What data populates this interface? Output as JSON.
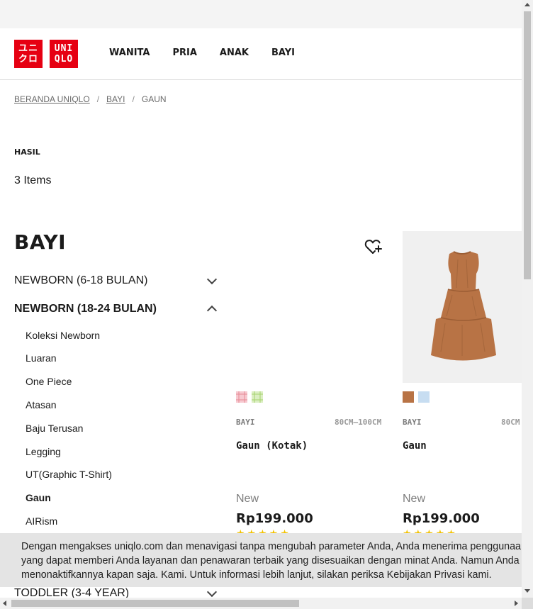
{
  "brand": {
    "logo_top": "ユニ",
    "logo_bottom": "クロ",
    "logo2_top": "UNI",
    "logo2_bottom": "QLO",
    "color": "#e60012"
  },
  "nav": [
    "WANITA",
    "PRIA",
    "ANAK",
    "BAYI"
  ],
  "breadcrumb": {
    "home": "BERANDA UNIQLO",
    "category": "BAYI",
    "current": "GAUN",
    "separator": "/"
  },
  "results": {
    "heading": "HASIL",
    "count": "3 Items"
  },
  "sidebar": {
    "title": "BAYI",
    "sections": [
      {
        "label": "NEWBORN (6-18 BULAN)",
        "expanded": false
      },
      {
        "label": "NEWBORN (18-24 BULAN)",
        "expanded": true
      }
    ],
    "subitems": [
      "Koleksi Newborn",
      "Luaran",
      "One Piece",
      "Atasan",
      "Baju Terusan",
      "Legging",
      "UT(Graphic T-Shirt)",
      "Gaun",
      "AIRism"
    ],
    "active_subitem": "Gaun",
    "toddler": "TODDLER (3-4 YEAR)"
  },
  "products": [
    {
      "category": "BAYI",
      "size": "80CM–100CM",
      "name": "Gaun (Kotak)",
      "badge": "New",
      "price": "Rp199.000",
      "colors": [
        "#f7c9d0",
        "#dbeec2"
      ]
    },
    {
      "category": "BAYI",
      "size": "80CM",
      "name": "Gaun",
      "badge": "New",
      "price": "Rp199.000",
      "colors": [
        "#b87345",
        "#c7ddf1"
      ]
    }
  ],
  "stars": "★★★★★",
  "cookie": {
    "text": "Dengan mengakses uniqlo.com dan menavigasi tanpa mengubah parameter Anda, Anda menerima penggunaan cookie yang dapat memberi Anda layanan dan penawaran terbaik yang disesuaikan dengan minat Anda. Namun Anda bisa menonaktifkannya kapan saja. Kami. Untuk informasi lebih lanjut, silakan periksa Kebijakan Privasi kami."
  },
  "icons": {
    "wishlist": "heart-plus-icon",
    "chevron_down": "chevron-down-icon",
    "chevron_up": "chevron-up-icon"
  }
}
